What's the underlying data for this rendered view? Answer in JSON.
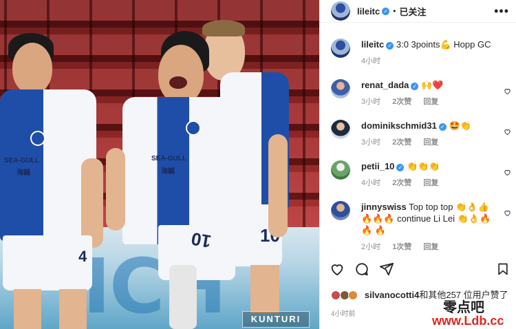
{
  "post": {
    "author": "lileitc",
    "follow_status": "已关注",
    "separator": "•",
    "more_label": "•••"
  },
  "caption": {
    "author": "lileitc",
    "text": "3:0 3points💪 Hopp GC",
    "time": "4小时"
  },
  "comments": [
    {
      "user": "renat_dada",
      "verified": true,
      "text": "🙌❤️",
      "time": "3小时",
      "likes": "2次赞",
      "reply": "回复"
    },
    {
      "user": "dominikschmid31",
      "verified": true,
      "text": "🤩👏",
      "time": "3小时",
      "likes": "2次赞",
      "reply": "回复"
    },
    {
      "user": "petii_10",
      "verified": true,
      "text": "👏👏👏",
      "time": "4小时",
      "likes": "2次赞",
      "reply": "回复"
    },
    {
      "user": "jinnyswiss",
      "verified": false,
      "text": "Top top top 👏👌👍 🔥🔥🔥 continue Li Lei 👏👌🔥🔥 🔥",
      "time": "2小时",
      "likes": "1次赞",
      "reply": "回复"
    }
  ],
  "likes_summary": {
    "user": "silvanocotti4",
    "text": "和其他257 位用户赞了"
  },
  "post_time": "4小时前",
  "photo": {
    "board_text": "ICH",
    "watermark": "KUNTURI",
    "sponsor": "SEA-GULL",
    "sponsor_cn": "海鷗",
    "numbers": [
      "4",
      "10",
      "10"
    ]
  },
  "site_watermark": {
    "cn": "零点吧",
    "url": "www.Ldb.cc"
  },
  "colors": {
    "accent_blue": "#1f4ea8",
    "verified_blue": "#3897f0",
    "heart_red": "#ed4956",
    "watermark_red": "#e0261b"
  }
}
